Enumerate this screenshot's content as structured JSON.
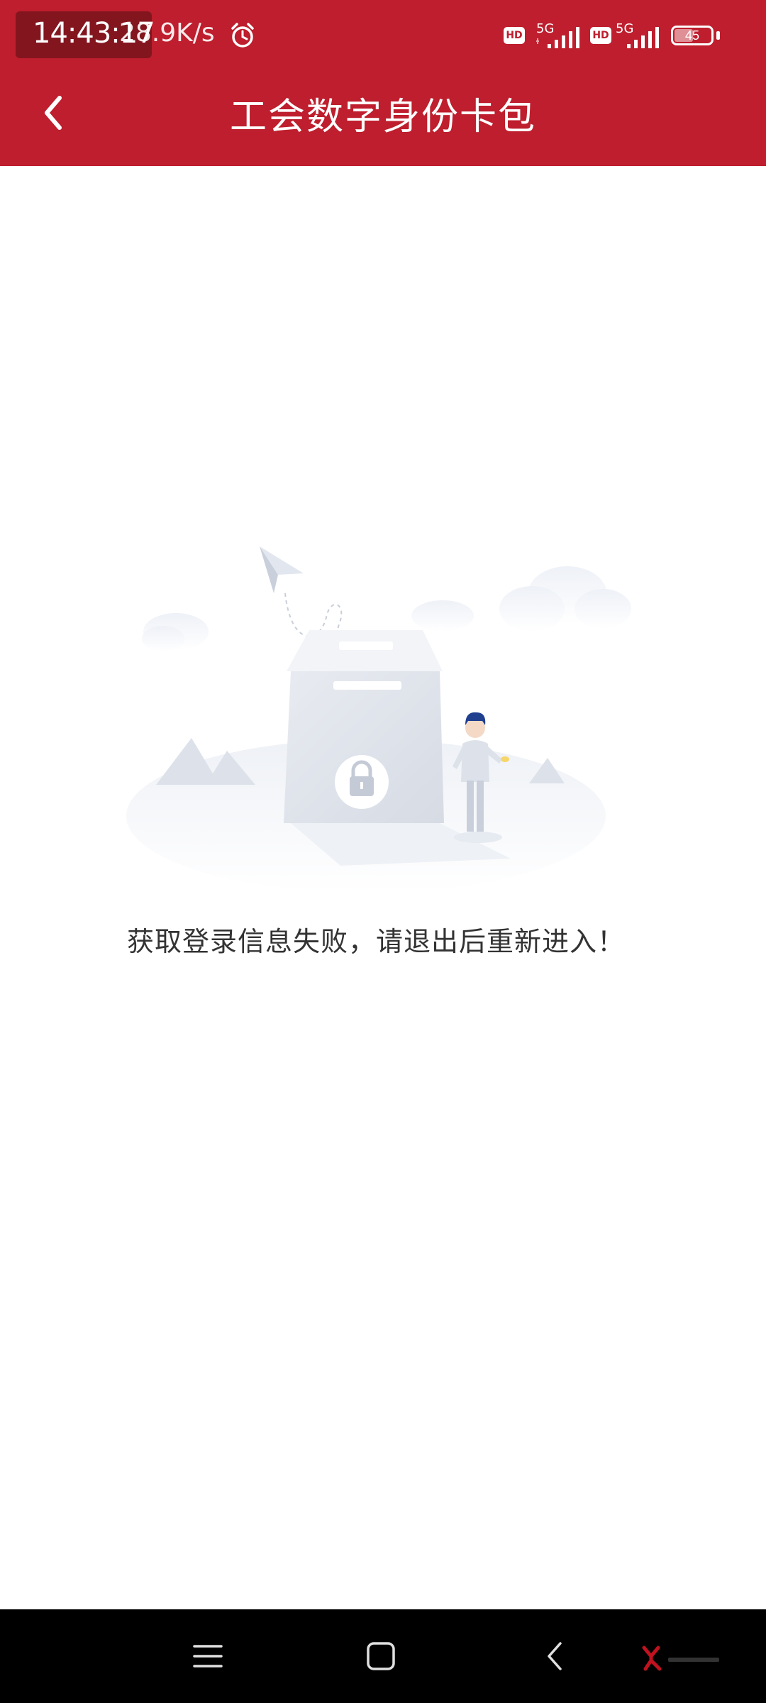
{
  "status_bar": {
    "time": "14:43:17",
    "speed": "28.9K/s",
    "hd1": "HD",
    "net1": "5G",
    "hd2": "HD",
    "net2": "5G",
    "battery": "45"
  },
  "header": {
    "title": "工会数字身份卡包"
  },
  "main": {
    "message": "获取登录信息失败，请退出后重新进入！"
  },
  "icons": {
    "back": "chevron-left-icon",
    "alarm": "alarm-clock-icon",
    "nav_menu": "menu-icon",
    "nav_home": "home-square-icon",
    "nav_back": "back-chevron-icon"
  },
  "colors": {
    "header": "#be1e2d",
    "navbar": "#000000",
    "message_text": "#333333"
  }
}
